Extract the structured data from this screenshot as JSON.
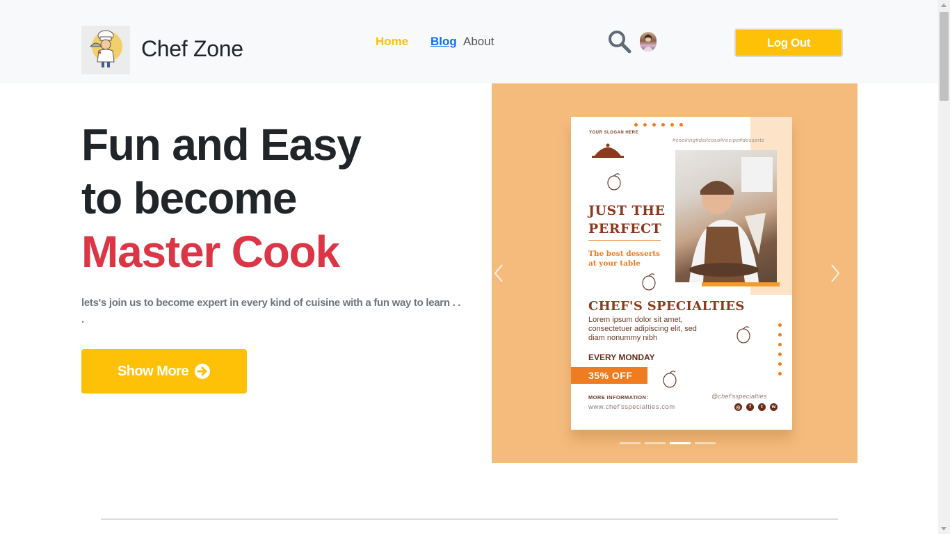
{
  "header": {
    "brand": "Chef Zone",
    "nav": {
      "home": "Home",
      "blog": "Blog",
      "about": "About"
    },
    "logout_label": "Log Out",
    "logo_icon": "chef-logo",
    "search_icon": "search-icon"
  },
  "hero": {
    "line1": "Fun and Easy",
    "line2": "to become",
    "line3": "Master Cook",
    "tagline": "lets's join us to become expert in every kind of cuisine with a fun way to learn . . .",
    "show_more_label": "Show More"
  },
  "carousel": {
    "active_slide": 3,
    "slide_count": 4,
    "poster": {
      "slogan": "YOUR SLOGAN HERE",
      "hashtags": "#cooking#delicoso#recipe#desserts",
      "headline_1": "JUST THE",
      "headline_2": "PERFECT",
      "subhead_1": "The best desserts",
      "subhead_2": "at your table",
      "specialties": "CHEF'S SPECIALTIES",
      "lorem_1": "Lorem ipsum dolor sit amet,",
      "lorem_2": "consectetuer adipiscing elit, sed",
      "lorem_3": "diam nonummy nibh",
      "every_monday": "EVERY MONDAY",
      "discount": "35% OFF",
      "more_info": "MORE INFORMATION:",
      "website": "www.chef'sspecialties.com",
      "handle": "@chef'sspecialties"
    }
  },
  "colors": {
    "accent": "#ffc107",
    "highlight": "#dc3545",
    "link": "#0d6efd",
    "carousel_bg": "#f4bb7c"
  }
}
